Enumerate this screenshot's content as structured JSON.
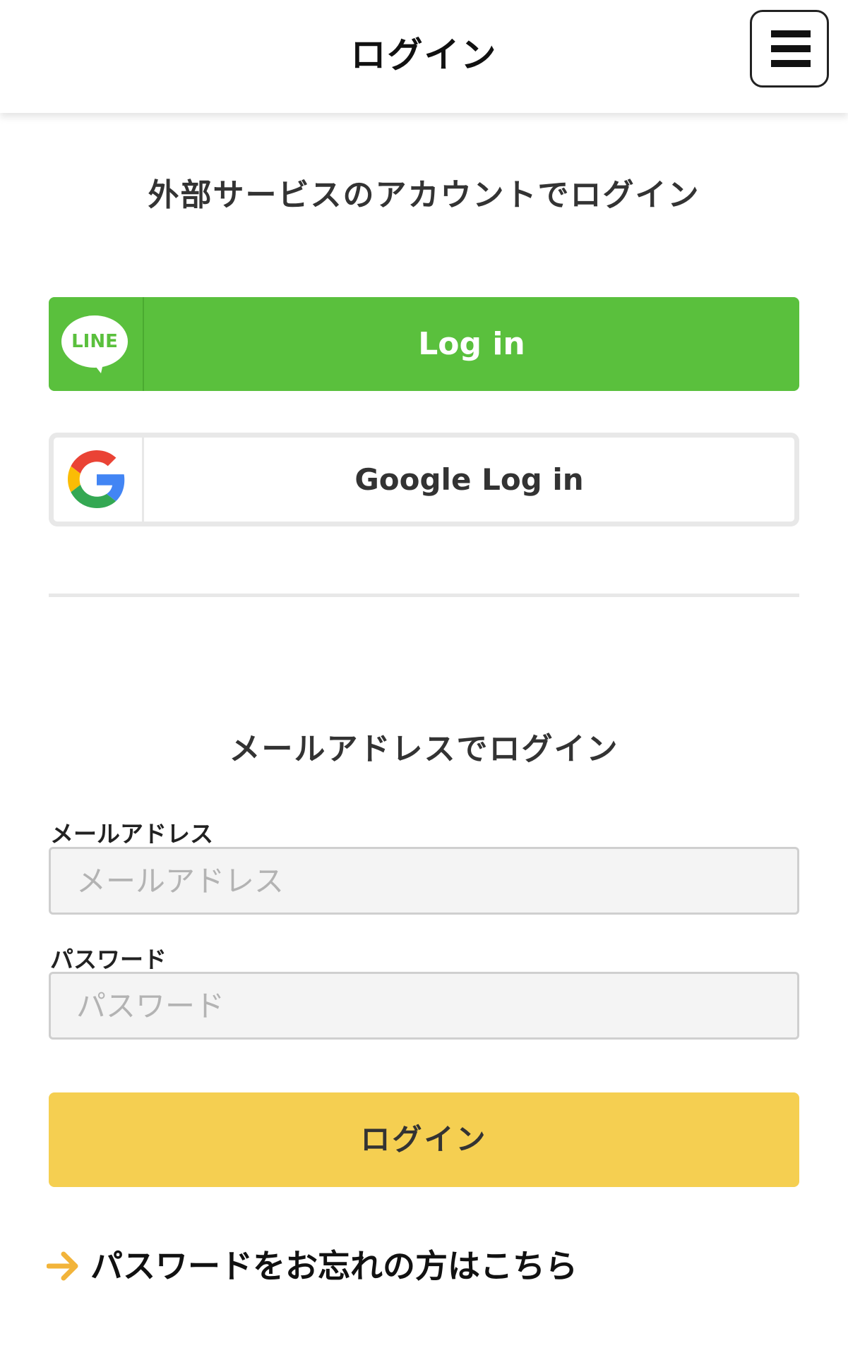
{
  "header": {
    "title": "ログイン",
    "menu_icon": "hamburger-menu-icon"
  },
  "external_login": {
    "title": "外部サービスのアカウントでログイン",
    "line_button": {
      "icon_text": "LINE",
      "label": "Log in",
      "color": "#5ac03d"
    },
    "google_button": {
      "label": "Google Log in",
      "icon": "google-g-icon"
    }
  },
  "email_login": {
    "title": "メールアドレスでログイン",
    "email": {
      "label": "メールアドレス",
      "placeholder": "メールアドレス",
      "value": ""
    },
    "password": {
      "label": "パスワード",
      "placeholder": "パスワード",
      "value": ""
    },
    "submit_label": "ログイン",
    "submit_color": "#f5cf51"
  },
  "forgot_password": {
    "label": "パスワードをお忘れの方はこちら",
    "arrow_color": "#f2b43a"
  }
}
